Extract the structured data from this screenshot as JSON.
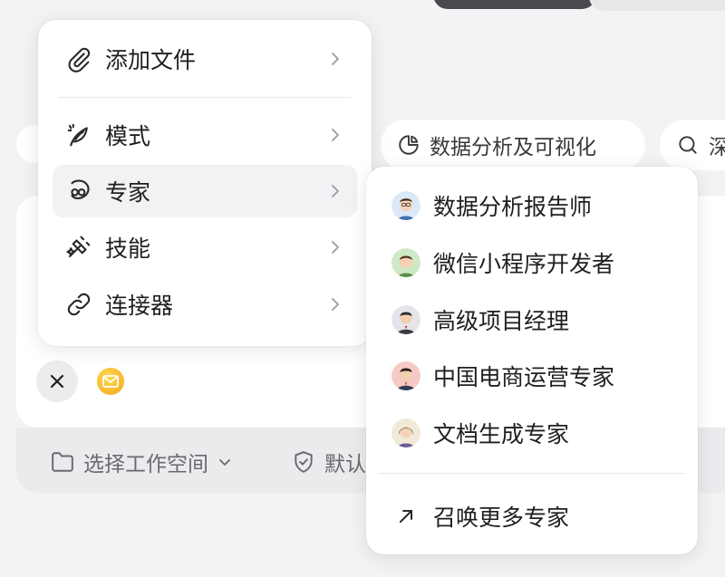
{
  "main_menu": {
    "items": [
      {
        "label": "添加文件",
        "icon": "paperclip-icon"
      },
      {
        "label": "模式",
        "icon": "feather-pen-icon"
      },
      {
        "label": "专家",
        "icon": "expert-icon"
      },
      {
        "label": "技能",
        "icon": "skill-icon"
      },
      {
        "label": "连接器",
        "icon": "link-icon"
      }
    ],
    "active_item": "专家"
  },
  "expert_submenu": {
    "experts": [
      {
        "label": "数据分析报告师",
        "avatar": "avatar-data-analyst"
      },
      {
        "label": "微信小程序开发者",
        "avatar": "avatar-wechat-developer"
      },
      {
        "label": "高级项目经理",
        "avatar": "avatar-project-manager"
      },
      {
        "label": "中国电商运营专家",
        "avatar": "avatar-ecommerce-expert"
      },
      {
        "label": "文档生成专家",
        "avatar": "avatar-document-expert"
      }
    ],
    "more_label": "召唤更多专家"
  },
  "suggestion_chips": {
    "data_viz": "数据分析及可视化",
    "deep_partial": "深"
  },
  "footer": {
    "workspace_label": "选择工作空间",
    "default_partial": "默认"
  },
  "colors": {
    "menu_bg": "#ffffff",
    "page_bg": "#f3f3f5",
    "active_item_bg": "#f2f2f4"
  }
}
